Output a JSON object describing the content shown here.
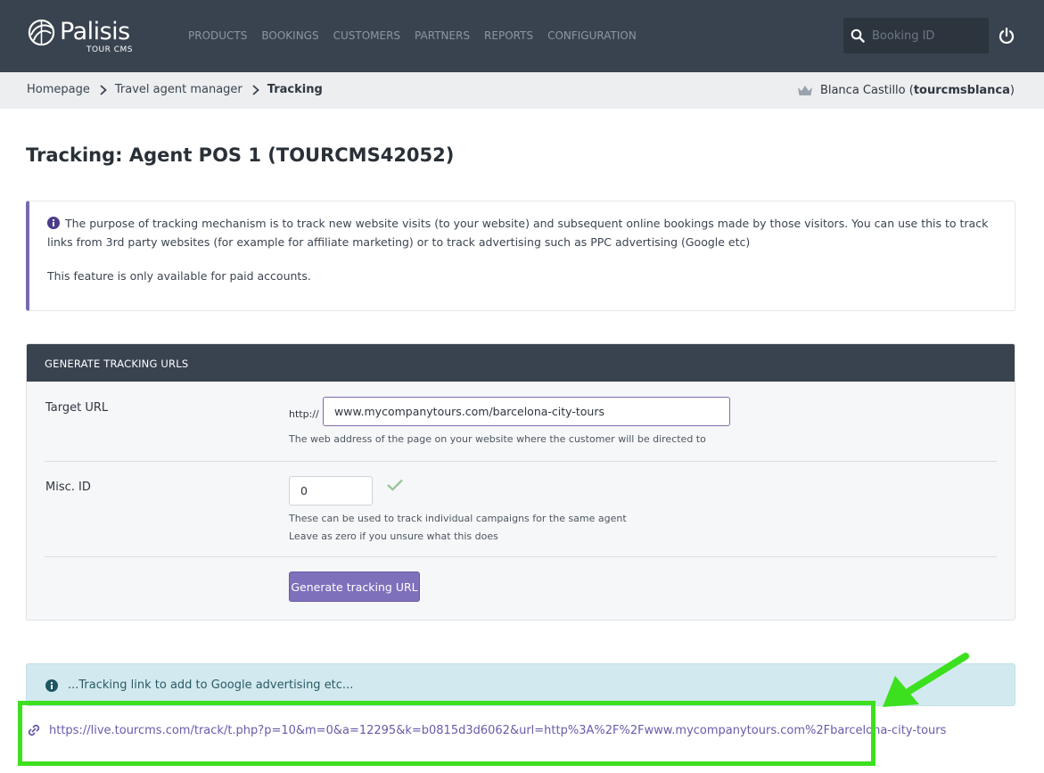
{
  "brand": {
    "name": "Palisis",
    "subtitle": "TOUR CMS"
  },
  "nav": {
    "items": [
      {
        "label": "PRODUCTS"
      },
      {
        "label": "BOOKINGS"
      },
      {
        "label": "CUSTOMERS"
      },
      {
        "label": "PARTNERS"
      },
      {
        "label": "REPORTS"
      },
      {
        "label": "CONFIGURATION"
      }
    ],
    "search": {
      "placeholder": "Booking ID",
      "value": ""
    }
  },
  "breadcrumb": {
    "items": [
      {
        "label": "Homepage"
      },
      {
        "label": "Travel agent manager"
      }
    ],
    "current": "Tracking"
  },
  "user": {
    "name": "Blanca Castillo",
    "username": "tourcmsblanca",
    "open_paren": " (",
    "close_paren": ")"
  },
  "page": {
    "title": "Tracking: Agent POS 1 (TOURCMS42052)"
  },
  "info": {
    "line1": "The purpose of tracking mechanism is to track new website visits (to your website) and subsequent online bookings made by those visitors. You can use this to track links from 3rd party websites (for example for affiliate marketing) or to track advertising such as PPC advertising (Google etc)",
    "line2": "This feature is only available for paid accounts."
  },
  "form": {
    "header": "GENERATE TRACKING URLS",
    "target_url": {
      "label": "Target URL",
      "prefix": "http://",
      "value": "www.mycompanytours.com/barcelona-city-tours",
      "help": "The web address of the page on your website where the customer will be directed to"
    },
    "misc_id": {
      "label": "Misc. ID",
      "value": "0",
      "help1": "These can be used to track individual campaigns for the same agent",
      "help2": "Leave as zero if you unsure what this does"
    },
    "button": "Generate tracking URL"
  },
  "result": {
    "notice": "...Tracking link to add to Google advertising etc...",
    "link": "https://live.tourcms.com/track/t.php?p=10&m=0&a=12295&k=b0815d3d6062&url=http%3A%2F%2Fwww.mycompanytours.com%2Fbarcelona-city-tours"
  },
  "colors": {
    "header_bg": "#39434f",
    "accent": "#7e70bb",
    "notice_bg": "#d2eaef",
    "annotation": "#3de01e"
  },
  "icons": [
    "logo-mark-icon",
    "search-icon",
    "power-icon",
    "chevron-right-icon",
    "crown-icon",
    "info-icon",
    "check-icon",
    "link-icon"
  ]
}
